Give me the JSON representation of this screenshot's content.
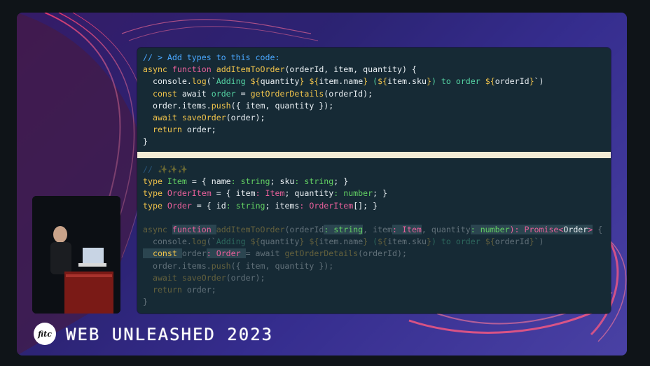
{
  "event": {
    "logo_text": "fitc",
    "title": "WEB UNLEASHED 2023"
  },
  "code": {
    "top": [
      {
        "parts": [
          {
            "t": "// > Add types to this code:",
            "c": "c"
          }
        ]
      },
      {
        "parts": [
          {
            "t": "async ",
            "c": "kw"
          },
          {
            "t": "function ",
            "c": "kw2"
          },
          {
            "t": "addItemToOrder",
            "c": "fn"
          },
          {
            "t": "(orderId, item, quantity) {",
            "c": "pl"
          }
        ]
      },
      {
        "parts": [
          {
            "t": "  console.",
            "c": "pl"
          },
          {
            "t": "log",
            "c": "fn"
          },
          {
            "t": "(`",
            "c": "pl"
          },
          {
            "t": "Adding ",
            "c": "str"
          },
          {
            "t": "${",
            "c": "kw"
          },
          {
            "t": "quantity",
            "c": "pl"
          },
          {
            "t": "} ",
            "c": "kw"
          },
          {
            "t": "${",
            "c": "kw"
          },
          {
            "t": "item.name",
            "c": "pl"
          },
          {
            "t": "} ",
            "c": "kw"
          },
          {
            "t": "(",
            "c": "str"
          },
          {
            "t": "${",
            "c": "kw"
          },
          {
            "t": "item.sku",
            "c": "pl"
          },
          {
            "t": "}",
            "c": "kw"
          },
          {
            "t": ") to order ",
            "c": "str"
          },
          {
            "t": "${",
            "c": "kw"
          },
          {
            "t": "orderId",
            "c": "pl"
          },
          {
            "t": "}",
            "c": "kw"
          },
          {
            "t": "`)",
            "c": "pl"
          }
        ]
      },
      {
        "parts": [
          {
            "t": "  const ",
            "c": "kw"
          },
          {
            "t": "await ",
            "c": "pl"
          },
          {
            "t": "order ",
            "c": "str"
          },
          {
            "t": "= ",
            "c": "pl"
          },
          {
            "t": "getOrderDetails",
            "c": "fn"
          },
          {
            "t": "(orderId);",
            "c": "pl"
          }
        ]
      },
      {
        "parts": [
          {
            "t": "  order.items.",
            "c": "pl"
          },
          {
            "t": "push",
            "c": "fn"
          },
          {
            "t": "({ item, quantity });",
            "c": "pl"
          }
        ]
      },
      {
        "parts": [
          {
            "t": "  await ",
            "c": "kw"
          },
          {
            "t": "saveOrder",
            "c": "fn"
          },
          {
            "t": "(order);",
            "c": "pl"
          }
        ]
      },
      {
        "parts": [
          {
            "t": "  return ",
            "c": "kw"
          },
          {
            "t": "order;",
            "c": "pl"
          }
        ]
      },
      {
        "parts": [
          {
            "t": "}",
            "c": "pl"
          }
        ]
      }
    ],
    "bottom": [
      {
        "dim": true,
        "parts": [
          {
            "t": "// ✨✨✨",
            "c": "c"
          }
        ]
      },
      {
        "parts": [
          {
            "t": "type ",
            "c": "kw"
          },
          {
            "t": "Item ",
            "c": "gr"
          },
          {
            "t": "= { name",
            "c": "pl"
          },
          {
            "t": ": string",
            "c": "gr"
          },
          {
            "t": "; sku",
            "c": "pl"
          },
          {
            "t": ": string",
            "c": "gr"
          },
          {
            "t": "; }",
            "c": "pl"
          }
        ]
      },
      {
        "parts": [
          {
            "t": "type ",
            "c": "kw"
          },
          {
            "t": "OrderItem ",
            "c": "tp"
          },
          {
            "t": "= { item",
            "c": "pl"
          },
          {
            "t": ": Item",
            "c": "tp"
          },
          {
            "t": "; quantity",
            "c": "pl"
          },
          {
            "t": ": number",
            "c": "gr"
          },
          {
            "t": "; }",
            "c": "pl"
          }
        ]
      },
      {
        "parts": [
          {
            "t": "type ",
            "c": "kw"
          },
          {
            "t": "Order ",
            "c": "tp"
          },
          {
            "t": "= { id",
            "c": "pl"
          },
          {
            "t": ": string",
            "c": "gr"
          },
          {
            "t": "; items",
            "c": "pl"
          },
          {
            "t": ": OrderItem",
            "c": "tp"
          },
          {
            "t": "[]; }",
            "c": "pl"
          }
        ]
      },
      {
        "parts": [
          {
            "t": " ",
            "c": "pl"
          }
        ]
      },
      {
        "parts": [
          {
            "t": "async ",
            "c": "kw",
            "dim": true
          },
          {
            "t": "function ",
            "c": "kw2",
            "hl": true
          },
          {
            "t": "addItemToOrder",
            "c": "fn",
            "dim": true
          },
          {
            "t": "(orderId",
            "c": "pl",
            "dim": true
          },
          {
            "t": ": string",
            "c": "gr",
            "hl": true
          },
          {
            "t": ", item",
            "c": "pl",
            "dim": true
          },
          {
            "t": ": Item",
            "c": "tp",
            "hl": true
          },
          {
            "t": ", quantity",
            "c": "pl",
            "dim": true
          },
          {
            "t": ": number",
            "c": "gr",
            "hl": true
          },
          {
            "t": "): Promise<",
            "c": "tp",
            "hl": true
          },
          {
            "t": "Order",
            "c": "pl",
            "hl": true
          },
          {
            "t": ">",
            "c": "tp",
            "hl": true
          },
          {
            "t": " {",
            "c": "pl",
            "dim": true
          }
        ]
      },
      {
        "dim": true,
        "parts": [
          {
            "t": "  console.",
            "c": "pl"
          },
          {
            "t": "log",
            "c": "fn"
          },
          {
            "t": "(`",
            "c": "pl"
          },
          {
            "t": "Adding ",
            "c": "str"
          },
          {
            "t": "${",
            "c": "kw"
          },
          {
            "t": "quantity",
            "c": "pl"
          },
          {
            "t": "} ",
            "c": "kw"
          },
          {
            "t": "${",
            "c": "kw"
          },
          {
            "t": "item.name",
            "c": "pl"
          },
          {
            "t": "} ",
            "c": "kw"
          },
          {
            "t": "(",
            "c": "str"
          },
          {
            "t": "${",
            "c": "kw"
          },
          {
            "t": "item.sku",
            "c": "pl"
          },
          {
            "t": "}",
            "c": "kw"
          },
          {
            "t": ") to order ",
            "c": "str"
          },
          {
            "t": "${",
            "c": "kw"
          },
          {
            "t": "orderId",
            "c": "pl"
          },
          {
            "t": "}",
            "c": "kw"
          },
          {
            "t": "`)",
            "c": "pl"
          }
        ]
      },
      {
        "parts": [
          {
            "t": "  const ",
            "c": "kw",
            "hl": true
          },
          {
            "t": "order",
            "c": "pl",
            "dim": true
          },
          {
            "t": ": Order ",
            "c": "tp",
            "hl": true
          },
          {
            "t": "= await ",
            "c": "pl",
            "dim": true
          },
          {
            "t": "getOrderDetails",
            "c": "fn",
            "dim": true
          },
          {
            "t": "(orderId);",
            "c": "pl",
            "dim": true
          }
        ]
      },
      {
        "dim": true,
        "parts": [
          {
            "t": "  order.items.",
            "c": "pl"
          },
          {
            "t": "push",
            "c": "fn"
          },
          {
            "t": "({ item, quantity });",
            "c": "pl"
          }
        ]
      },
      {
        "dim": true,
        "parts": [
          {
            "t": "  await ",
            "c": "kw"
          },
          {
            "t": "saveOrder",
            "c": "fn"
          },
          {
            "t": "(order);",
            "c": "pl"
          }
        ]
      },
      {
        "dim": true,
        "parts": [
          {
            "t": "  return ",
            "c": "kw"
          },
          {
            "t": "order;",
            "c": "pl"
          }
        ]
      },
      {
        "dim": true,
        "parts": [
          {
            "t": "}",
            "c": "pl"
          }
        ]
      }
    ]
  },
  "colors": {
    "panel_bg": "#162a35",
    "divider": "#f3ecd6",
    "comment": "#4aa8ff",
    "keyword": "#f0c34b",
    "function_keyword": "#e9609b",
    "string": "#55d4a4",
    "type": "#e9609b",
    "primitive": "#63d163",
    "text": "#e8eef2"
  }
}
